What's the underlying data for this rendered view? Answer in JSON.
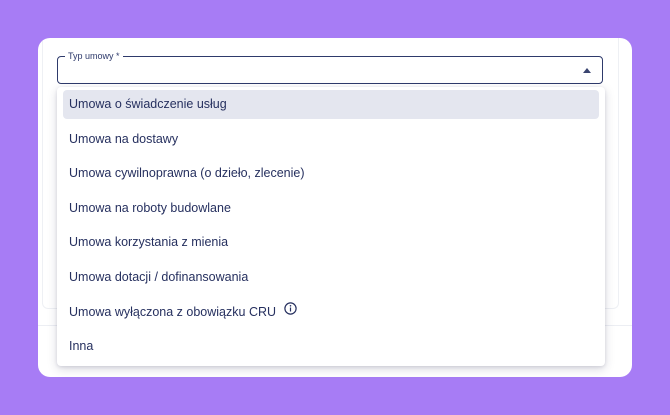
{
  "form": {
    "contract_type_label": "Typ umowy *"
  },
  "dropdown": {
    "options": [
      {
        "label": "Umowa o świadczenie usług",
        "selected": true
      },
      {
        "label": "Umowa na dostawy"
      },
      {
        "label": "Umowa cywilnoprawna (o dzieło, zlecenie)"
      },
      {
        "label": "Umowa na roboty budowlane"
      },
      {
        "label": "Umowa korzystania z mienia"
      },
      {
        "label": "Umowa dotacji / dofinansowania"
      },
      {
        "label": "Umowa wyłączona z obowiązku CRU",
        "icon": "info-icon"
      },
      {
        "label": "Inna"
      }
    ]
  },
  "colors": {
    "background": "#a77cf5",
    "text": "#26305f",
    "selected_option": "#e4e6ef",
    "field_border": "#2e3a6b"
  }
}
